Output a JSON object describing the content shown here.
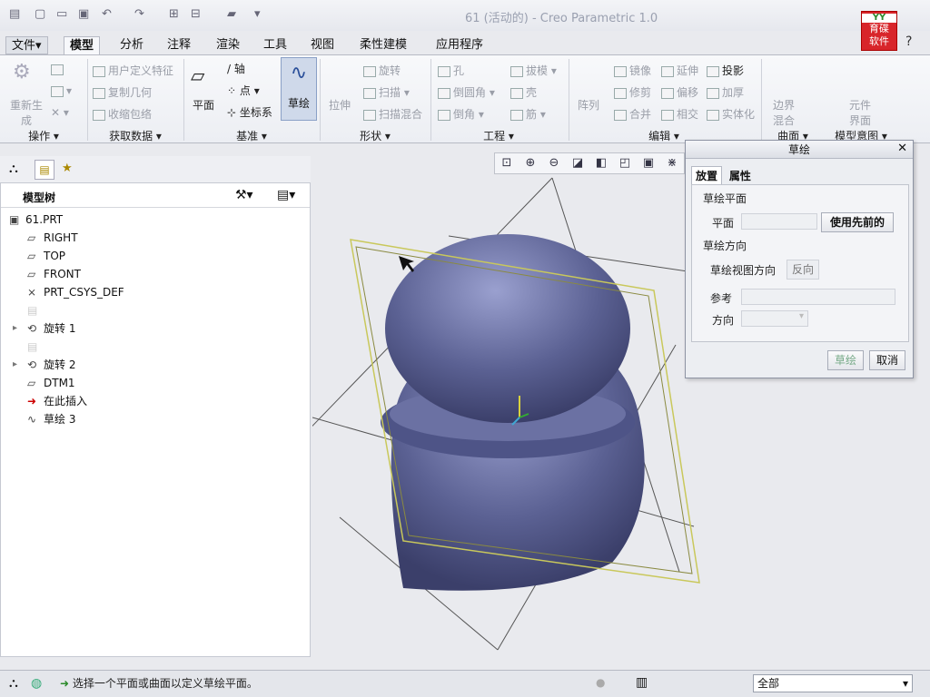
{
  "window": {
    "title": "61 (活动的) - Creo Parametric 1.0"
  },
  "menu": {
    "items": [
      "文件",
      "模型",
      "分析",
      "注释",
      "渲染",
      "工具",
      "视图",
      "柔性建模",
      "应用程序"
    ],
    "active": "模型"
  },
  "ribbon": {
    "operations": {
      "regen": "重新生成",
      "group": "操作"
    },
    "get_data": {
      "udf": "用户定义特征",
      "copy_geom": "复制几何",
      "shrinkwrap": "收缩包络",
      "group": "获取数据"
    },
    "datum": {
      "plane": "平面",
      "axis": "轴",
      "point": "点",
      "csys": "坐标系",
      "group": "基准"
    },
    "sketch": {
      "label": "草绘"
    },
    "shapes": {
      "extrude": "拉伸",
      "revolve": "旋转",
      "sweep": "扫描",
      "swept_blend": "扫描混合",
      "group": "形状"
    },
    "engineering": {
      "hole": "孔",
      "round": "倒圆角",
      "chamfer": "倒角",
      "draft": "拔模",
      "shell": "壳",
      "rib": "筋",
      "group": "工程"
    },
    "editing": {
      "pattern": "阵列",
      "mirror": "镜像",
      "trim": "修剪",
      "merge": "合并",
      "extend": "延伸",
      "offset": "偏移",
      "intersect": "相交",
      "project": "投影",
      "thicken": "加厚",
      "solidify": "实体化",
      "group": "编辑"
    },
    "surfaces": {
      "boundary": "边界混合",
      "group": "曲面"
    },
    "model_intent": {
      "component_interface": "元件界面",
      "group": "模型意图"
    }
  },
  "model_tree": {
    "title": "模型树",
    "items": [
      {
        "label": "61.PRT",
        "icon": "part-icon",
        "expand": false
      },
      {
        "label": "RIGHT",
        "icon": "datum-plane-icon",
        "expand": false
      },
      {
        "label": "TOP",
        "icon": "datum-plane-icon",
        "expand": false
      },
      {
        "label": "FRONT",
        "icon": "datum-plane-icon",
        "expand": false
      },
      {
        "label": "PRT_CSYS_DEF",
        "icon": "csys-icon",
        "expand": false
      },
      {
        "label": "",
        "icon": "hidden-feature-icon",
        "expand": false
      },
      {
        "label": "旋转 1",
        "icon": "revolve-icon",
        "expand": true
      },
      {
        "label": "",
        "icon": "hidden-feature-icon",
        "expand": false
      },
      {
        "label": "旋转 2",
        "icon": "revolve-icon",
        "expand": true
      },
      {
        "label": "DTM1",
        "icon": "datum-plane-icon",
        "expand": false
      },
      {
        "label": "在此插入",
        "icon": "insert-here-icon",
        "expand": false
      },
      {
        "label": "草绘 3",
        "icon": "sketch-icon",
        "expand": false
      }
    ]
  },
  "sketch_dialog": {
    "title": "草绘",
    "tabs": [
      "放置",
      "属性"
    ],
    "sketch_plane_label": "草绘平面",
    "plane_label": "平面",
    "plane_value": "",
    "use_previous": "使用先前的",
    "orientation_label": "草绘方向",
    "view_direction_label": "草绘视图方向",
    "flip": "反向",
    "reference_label": "参考",
    "direction_label": "方向",
    "ok": "草绘",
    "cancel": "取消"
  },
  "status": {
    "message": "选择一个平面或曲面以定义草绘平面。",
    "filter": "全部"
  },
  "colors": {
    "model": "#5b6193",
    "datum_plane": "#c9c85b",
    "highlight": "#cfd9ea"
  }
}
